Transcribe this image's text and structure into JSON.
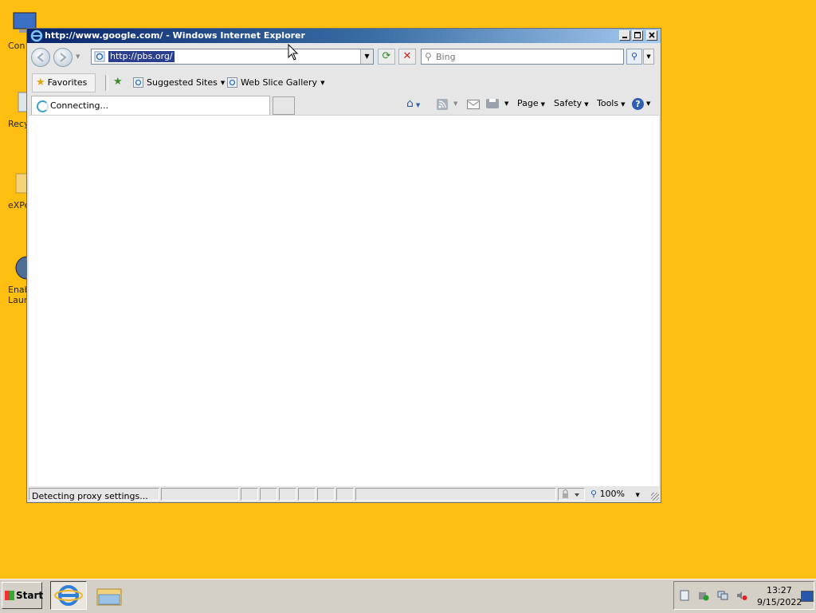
{
  "desktop": {
    "icons": [
      {
        "label": "Con"
      },
      {
        "label": "Recy"
      },
      {
        "label": "eXPe"
      },
      {
        "label": "Enab"
      },
      {
        "label": "Laun"
      }
    ]
  },
  "window": {
    "title": "http://www.google.com/ - Windows Internet Explorer",
    "address": "http://pbs.org/",
    "search_placeholder": "Bing",
    "favorites_label": "Favorites",
    "suggested_sites": "Suggested Sites",
    "web_slice_gallery": "Web Slice Gallery",
    "tab_title": "Connecting...",
    "commands": {
      "page": "Page",
      "safety": "Safety",
      "tools": "Tools"
    },
    "status": "Detecting proxy settings...",
    "zoom": "100%"
  },
  "taskbar": {
    "start_label": "Start",
    "clock_time": "13:27",
    "clock_date": "9/15/2022"
  },
  "colors": {
    "desktop": "#FEBF10",
    "title_gradient_start": "#0A246A",
    "selection": "#2B3F8E"
  }
}
